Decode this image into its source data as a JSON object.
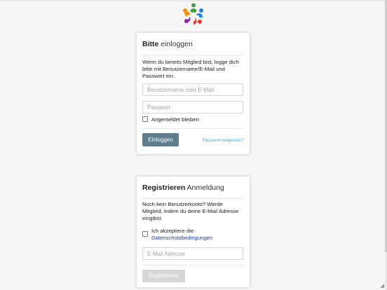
{
  "brand": {
    "logo_icon": "people-circle-logo-icon",
    "colors": [
      "#e53935",
      "#1e88e5",
      "#43a047",
      "#fb8c00",
      "#8e24aa"
    ]
  },
  "login": {
    "title_bold": "Bitte",
    "title_rest": "einloggen",
    "description": "Wenn du bereits Mitglied bist, logge dich bitte mit Benutzername/E-Mail und Passwort ein.",
    "username_placeholder": "Benutzername oder E-Mail",
    "username_value": "",
    "password_placeholder": "Passwort",
    "password_value": "",
    "remember_label": "Angemeldet bleiben",
    "remember_checked": false,
    "login_button": "Einloggen",
    "forgot_link": "Passwort vergessen?",
    "accent": "#5f7d8c",
    "link_color": "#2bb3d6"
  },
  "register": {
    "title_bold": "Registrieren",
    "title_rest": "Anmeldung",
    "description": "Noch kein Benutzerkonto? Werde Mitglied, indem du deine E-Mail Adresse eingibst.",
    "consent_prefix": "Ich akzeptiere die",
    "consent_link": "Datenschutzbedingungen",
    "consent_checked": false,
    "email_placeholder": "E-Mail Adresse",
    "email_value": "",
    "register_button": "Registrieren",
    "button_disabled_color": "#d6d6d6"
  }
}
